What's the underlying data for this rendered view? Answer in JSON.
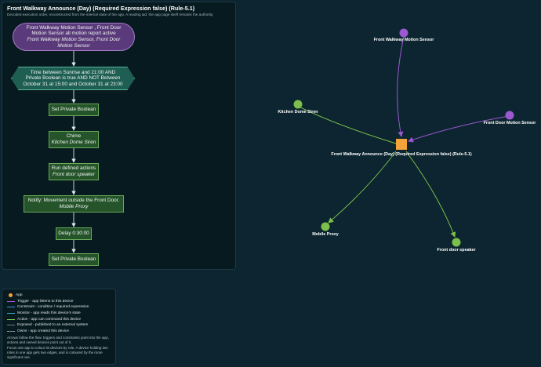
{
  "panel": {
    "title": "Front Walkway Announce (Day) (Required Expression false) (Rule-5.1)",
    "subtitle": "Decoded execution order, reconstructed from the internal state of the app. A reading aid: the app page itself remains the authority."
  },
  "flow": {
    "trigger": {
      "line1": "Front Walkway Motion Sensor , Front Door Motion Sensor all motion report active",
      "line2": "Front Walkway Motion Sensor, Front Door Motion Sensor"
    },
    "condition": "Time between Sunrise and 21:00 AND Private Boolean is true AND NOT Between October 31 at 15:00 and October 31 at 23:00",
    "actions": [
      {
        "title": "Set Private Boolean",
        "sub": ""
      },
      {
        "title": "Chime",
        "sub": "Kitchen Dome Siren"
      },
      {
        "title": "Run defined actions",
        "sub": "Front door speaker"
      },
      {
        "title": "Notify: Movement outside the Front Door.",
        "sub": "Mobile Proxy"
      },
      {
        "title": "Delay 0:30:00",
        "sub": ""
      },
      {
        "title": "Set Private Boolean",
        "sub": ""
      }
    ]
  },
  "legend": {
    "app": "App",
    "items": [
      {
        "label": "Trigger - app listens to this device",
        "color": "#9b59d0",
        "style": "solid"
      },
      {
        "label": "Constraint - condition / required expression",
        "color": "#4a90d9",
        "style": "solid"
      },
      {
        "label": "Monitor - app reads this device's state",
        "color": "#3fb6c9",
        "style": "solid"
      },
      {
        "label": "Action - app can command this device",
        "color": "#7cbf4a",
        "style": "solid"
      },
      {
        "label": "Exposed - published to an external system",
        "color": "#6b7f8a",
        "style": "solid"
      },
      {
        "label": "Owns - app created this device",
        "color": "#9aa7ad",
        "style": "dashed"
      }
    ],
    "note1": "Arrows follow the flow: triggers and constraints point into the app, actions and owned devices point out of it.",
    "note2": "Focus one app to colour its devices by role. A device holding two roles in one app gets two edges, and is coloured by the more significant one."
  },
  "graph": {
    "app": {
      "label": "Front Walkway Announce (Day) (Required Expression false) (Rule-5.1)",
      "color": "#f2a33a"
    },
    "devices": [
      {
        "key": "front-walkway-motion-sensor",
        "label": "Front Walkway Motion Sensor",
        "role": "trigger"
      },
      {
        "key": "front-door-motion-sensor",
        "label": "Front Door Motion Sensor",
        "role": "trigger"
      },
      {
        "key": "kitchen-dome-siren",
        "label": "Kitchen Dome Siren",
        "role": "action"
      },
      {
        "key": "mobile-proxy",
        "label": "Mobile Proxy",
        "role": "action"
      },
      {
        "key": "front-door-speaker",
        "label": "Front door speaker",
        "role": "action"
      }
    ],
    "colors": {
      "trigger": "#9b59d0",
      "action": "#7cbf4a"
    }
  }
}
